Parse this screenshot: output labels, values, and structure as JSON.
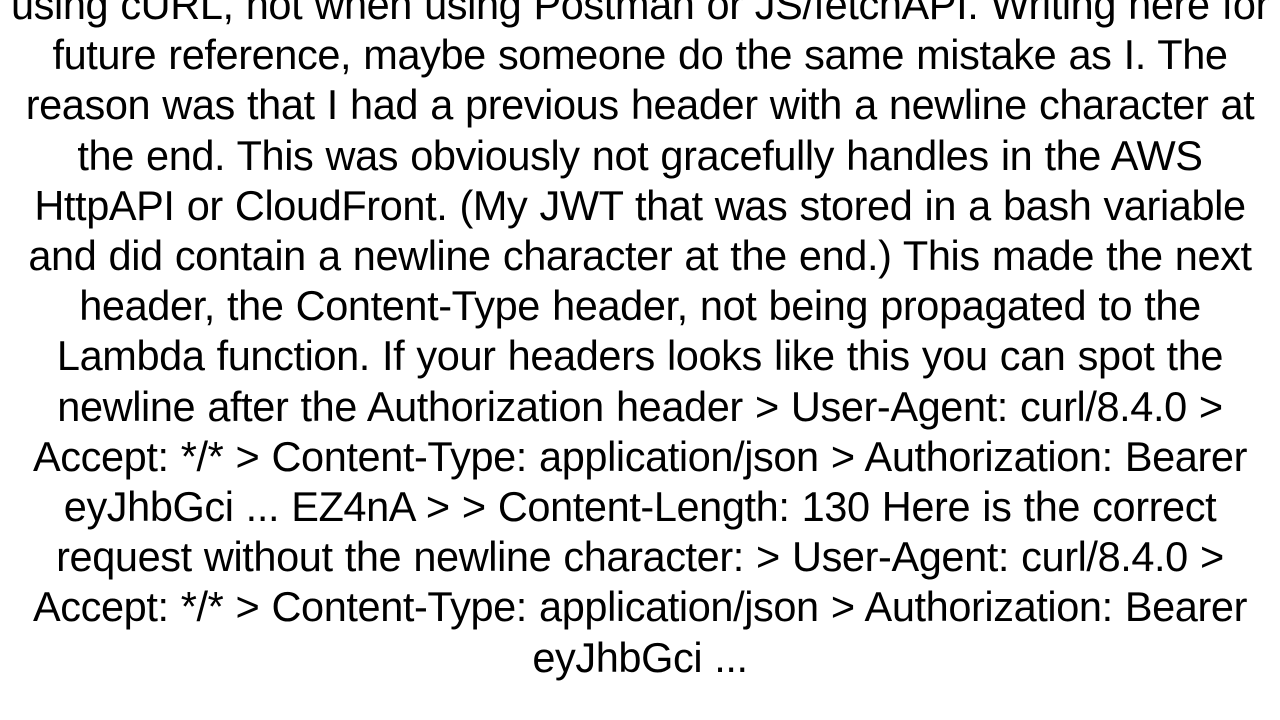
{
  "document": {
    "body_text": "using cURL, not when using Postman or JS/fetchAPI. Writing here for future reference, maybe someone do the same mistake as I. The reason was that I had a previous header with a newline character at the end. This was obviously not gracefully handles in the AWS HttpAPI or CloudFront. (My JWT that was stored in a bash variable and did contain a newline character at the end.) This made the next header, the Content-Type header, not being propagated to the Lambda function. If your headers looks like this you can spot the newline after the Authorization header > User-Agent: curl/8.4.0 > Accept: */* > Content-Type: application/json > Authorization: Bearer eyJhbGci ... EZ4nA > > Content-Length: 130  Here is the correct request without the newline character: > User-Agent: curl/8.4.0 > Accept: */* > Content-Type: application/json > Authorization: Bearer eyJhbGci ..."
  }
}
